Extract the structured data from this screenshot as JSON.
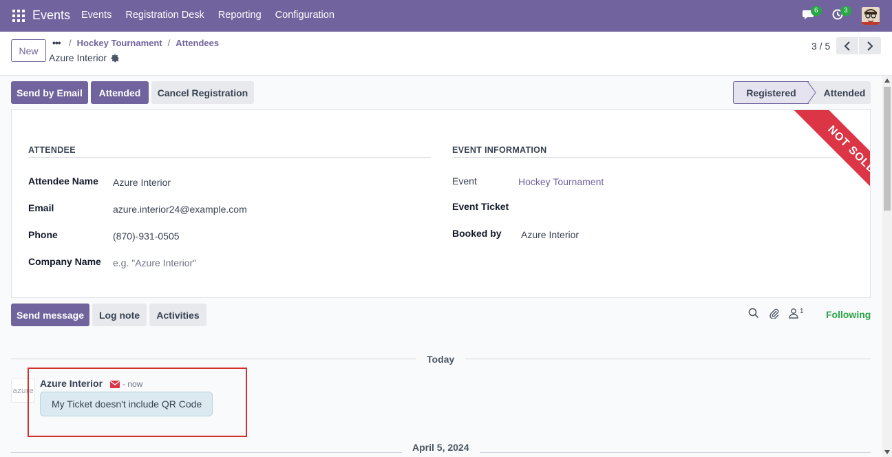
{
  "navbar": {
    "brand": "Events",
    "menu": [
      "Events",
      "Registration Desk",
      "Reporting",
      "Configuration"
    ],
    "chat_badge": "6",
    "activity_badge": "3"
  },
  "control": {
    "new_label": "New",
    "breadcrumb": [
      "Hockey Tournament",
      "Attendees"
    ],
    "record_name": "Azure Interior",
    "pager": "3 / 5"
  },
  "actions": {
    "send_email": "Send by Email",
    "attended": "Attended",
    "cancel": "Cancel Registration"
  },
  "status": {
    "registered": "Registered",
    "attended": "Attended"
  },
  "ribbon": "NOT SOLD",
  "attendee": {
    "title": "ATTENDEE",
    "name_label": "Attendee Name",
    "name_value": "Azure Interior",
    "email_label": "Email",
    "email_value": "azure.interior24@example.com",
    "phone_label": "Phone",
    "phone_value": "(870)-931-0505",
    "company_label": "Company Name",
    "company_placeholder": "e.g. \"Azure Interior\""
  },
  "event_info": {
    "title": "EVENT INFORMATION",
    "event_label": "Event",
    "event_value": "Hockey Tournament",
    "ticket_label": "Event Ticket",
    "booked_label": "Booked by",
    "booked_value": "Azure Interior"
  },
  "chatter": {
    "send_message": "Send message",
    "log_note": "Log note",
    "activities": "Activities",
    "followers_count": "1",
    "following": "Following",
    "date_today": "Today",
    "date_prev": "April 5, 2024",
    "avatar_text": "azure",
    "message": {
      "author": "Azure Interior",
      "time": "- now",
      "body": "My Ticket doesn't include QR Code"
    }
  },
  "colors": {
    "brand": "#71639e",
    "ribbon": "#dc3545",
    "following": "#28a745"
  }
}
